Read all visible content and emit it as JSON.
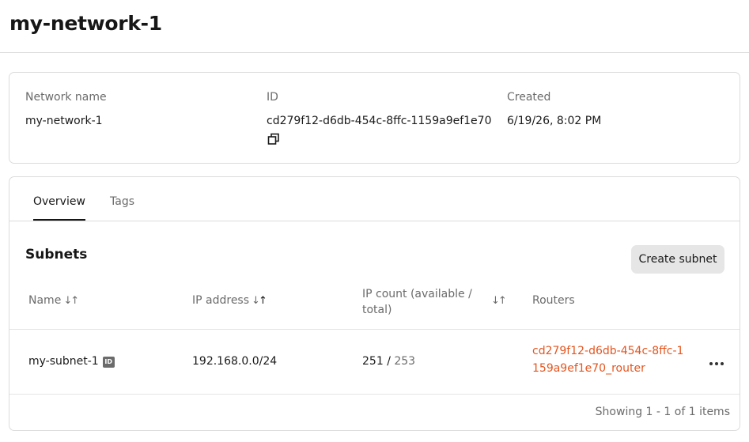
{
  "page": {
    "title": "my-network-1"
  },
  "info": {
    "network_name_label": "Network name",
    "network_name_value": "my-network-1",
    "id_label": "ID",
    "id_value": "cd279f12-d6db-454c-8ffc-1159a9ef1e70",
    "created_label": "Created",
    "created_value": "6/19/26, 8:02 PM"
  },
  "tabs": [
    {
      "label": "Overview",
      "active": true
    },
    {
      "label": "Tags",
      "active": false
    }
  ],
  "subnets": {
    "title": "Subnets",
    "create_label": "Create subnet",
    "columns": {
      "name": "Name",
      "ip_address": "IP address",
      "ip_count": "IP count (available / total)",
      "routers": "Routers"
    },
    "sort_glyph": "↓↑",
    "id_badge": "ID",
    "rows": [
      {
        "name": "my-subnet-1",
        "ip_address": "192.168.0.0/24",
        "ip_available": "251",
        "ip_separator": "/",
        "ip_total": "253",
        "router": "cd279f12-d6db-454c-8ffc-1159a9ef1e70_router"
      }
    ],
    "footer": "Showing 1 - 1 of 1 items"
  },
  "colors": {
    "link": "#e5551f",
    "muted_text": "#6b6b6b",
    "border": "#dcdcdc",
    "button_bg": "#e6e6e6"
  }
}
